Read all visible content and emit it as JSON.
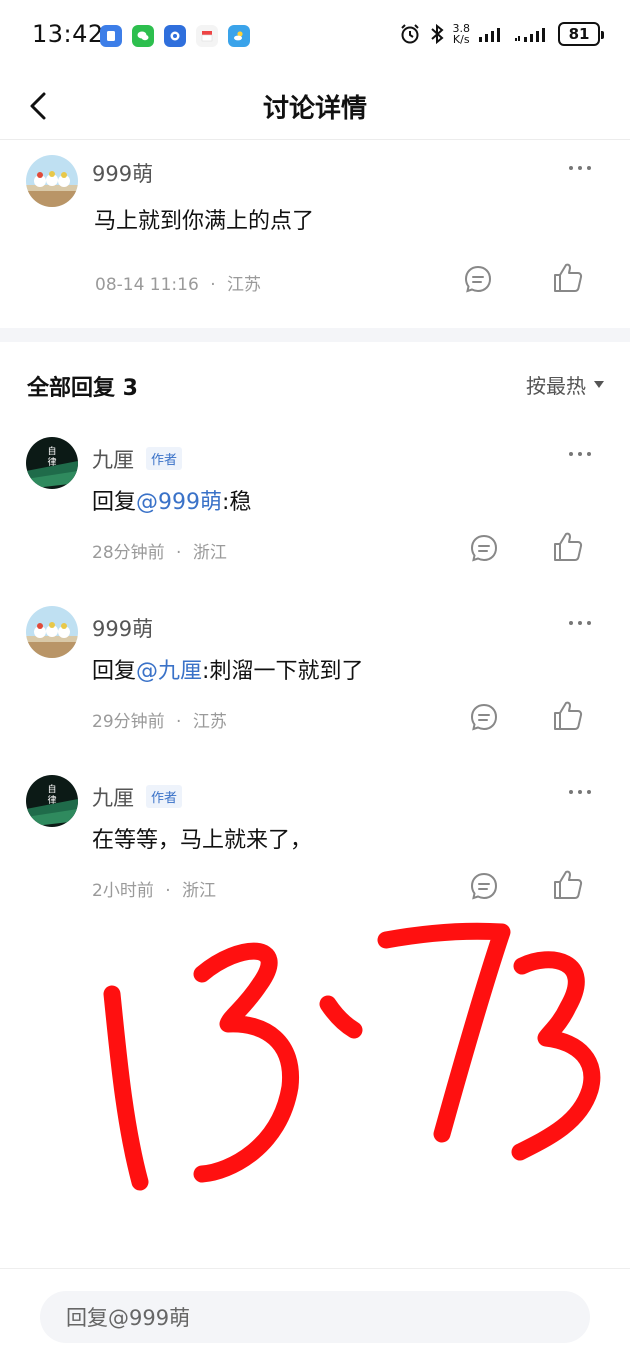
{
  "status": {
    "time": "13:42",
    "net_speed_value": "3.8",
    "net_speed_unit": "K/s",
    "battery": "81"
  },
  "header": {
    "title": "讨论详情"
  },
  "main_comment": {
    "user": "999萌",
    "text": "马上就到你满上的点了",
    "time": "08-14 11:16",
    "location": "江苏"
  },
  "replies_section": {
    "title": "全部回复 3",
    "sort_label": "按最热"
  },
  "replies": [
    {
      "user": "九厘",
      "tag": "作者",
      "prefix": "回复",
      "mention": "@999萌",
      "text": ":稳",
      "time": "28分钟前",
      "location": "浙江"
    },
    {
      "user": "999萌",
      "tag": "",
      "prefix": "回复",
      "mention": "@九厘",
      "text": ":刺溜一下就到了",
      "time": "29分钟前",
      "location": "江苏"
    },
    {
      "user": "九厘",
      "tag": "作者",
      "prefix": "",
      "mention": "",
      "text": "在等等，马上就来了，",
      "time": "2小时前",
      "location": "浙江"
    }
  ],
  "meta_separator": "·",
  "handwriting": "13:73",
  "bottom_bar": {
    "placeholder": "回复@999萌"
  },
  "colors": {
    "mention": "#3a72c8",
    "handwriting": "#ff1010",
    "meta": "#9a9a9a"
  }
}
